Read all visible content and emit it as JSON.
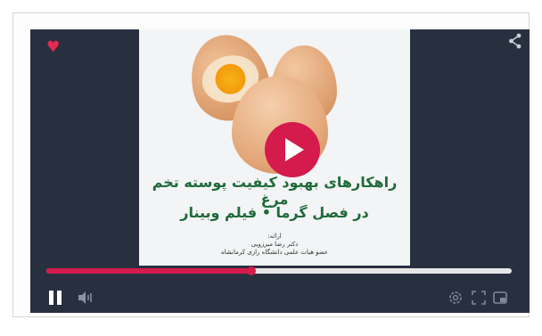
{
  "video": {
    "title_line1": "راهکارهای بهبود کیفیت پوسته تخم مرغ",
    "title_line2": "در فصل گرما • فیلم وبینار",
    "credit_label": "ارائه:",
    "credit_name": "دکتر رضا میرزویی",
    "credit_affiliation": "عضو هیات علمی دانشگاه رازی کرمانشاه",
    "progress": 0.44
  },
  "colors": {
    "accent": "#d51a4c",
    "player_bg": "#283040",
    "title_green": "#1f6a3a"
  },
  "icons": {
    "heart": "heart-icon",
    "share": "share-icon",
    "play": "play-icon",
    "pause": "pause-icon",
    "volume": "volume-icon",
    "settings": "settings-icon",
    "fullscreen": "fullscreen-icon",
    "pip": "pip-icon"
  }
}
